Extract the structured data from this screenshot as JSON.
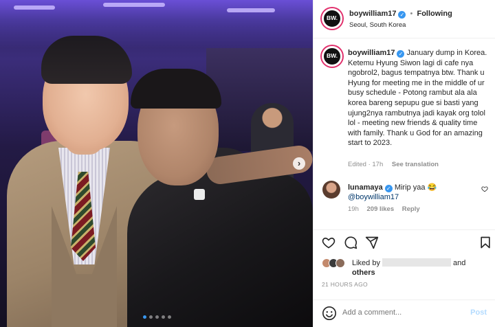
{
  "post": {
    "username": "boywilliam17",
    "avatar_text": "BW.",
    "follow_label": "Following",
    "separator": "•",
    "location": "Seoul, South Korea",
    "caption": "January dump in Korea. Ketemu Hyung Siwon lagi di cafe nya ngobrol2, bagus tempatnya btw. Thank u Hyung for meeting me in the middle of ur busy schedule - Potong rambut ala ala korea bareng sepupu gue si basti yang ujung2nya rambutnya jadi kayak org tolol lol - meeting new friends & quality time with family. Thank u God for an amazing start to 2023.",
    "edited": "Edited · 17h",
    "see_translation": "See translation"
  },
  "comment": {
    "username": "lunamaya",
    "text": "Mirip yaa 😂",
    "mention": "@boywilliam17",
    "age": "19h",
    "likes": "209 likes",
    "reply": "Reply"
  },
  "likes": {
    "prefix": "Liked by",
    "suffix": "and",
    "others": "others"
  },
  "timestamp": "21 HOURS AGO",
  "add_comment": {
    "placeholder": "Add a comment...",
    "post_label": "Post"
  },
  "carousel": {
    "next": "›",
    "dots_count": 5,
    "active_index": 0
  },
  "colors": {
    "verified": "#3897f0",
    "link": "#00376b",
    "post_disabled": "#b3dbff",
    "ring": "#e1306c"
  },
  "icons": [
    "heart-icon",
    "comment-icon",
    "share-icon",
    "bookmark-icon",
    "emoji-icon",
    "verified-icon",
    "chevron-right-icon"
  ]
}
